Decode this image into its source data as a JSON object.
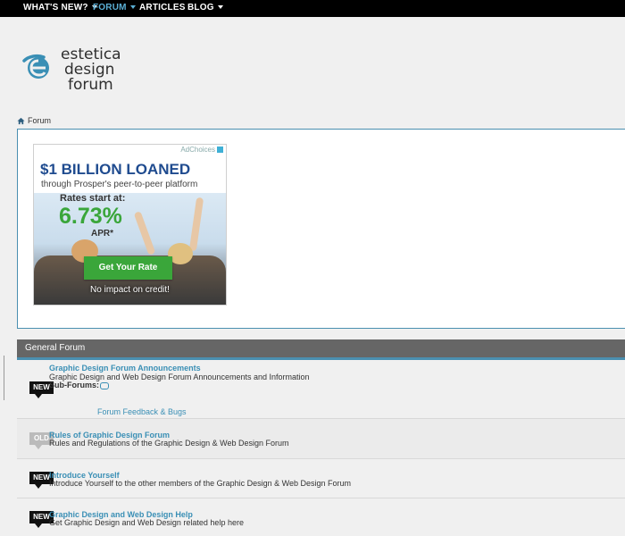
{
  "nav": {
    "whats_new": "WHAT'S NEW?",
    "forum": "FORUM",
    "articles": "ARTICLES",
    "blog": "BLOG"
  },
  "logo": {
    "line1": "estetica",
    "line2": "design",
    "line3": "forum"
  },
  "breadcrumb": {
    "label": "Forum"
  },
  "ad": {
    "adchoices": "AdChoices",
    "headline": "$1 BILLION LOANED",
    "sub": "through Prosper's peer-to-peer platform",
    "rates_label": "Rates start at:",
    "rate": "6.73%",
    "apr": "APR*",
    "cta": "Get Your Rate",
    "note": "No impact on credit!"
  },
  "section": {
    "title": "General Forum"
  },
  "forums": [
    {
      "badge": "NEW",
      "title": "Graphic Design Forum Announcements",
      "desc": "Graphic Design and Web Design Forum Announcements and Information",
      "subforums_label": "Sub-Forums:",
      "sublink": "Forum Feedback & Bugs"
    },
    {
      "badge": "OLD",
      "title": "Rules of Graphic Design Forum",
      "desc": "Rules and Regulations of the Graphic Design & Web Design Forum"
    },
    {
      "badge": "NEW",
      "title": "Introduce Yourself",
      "desc": "Introduce Yourself to the other members of the Graphic Design & Web Design Forum"
    },
    {
      "badge": "NEW",
      "title": "Graphic Design and Web Design Help",
      "desc": "Get Graphic Design and Web Design related help here"
    }
  ],
  "colors": {
    "accent": "#3a8fb5",
    "nav_active": "#5bb0d6",
    "ad_green": "#3aa63a",
    "ad_blue": "#1f4b8f"
  }
}
